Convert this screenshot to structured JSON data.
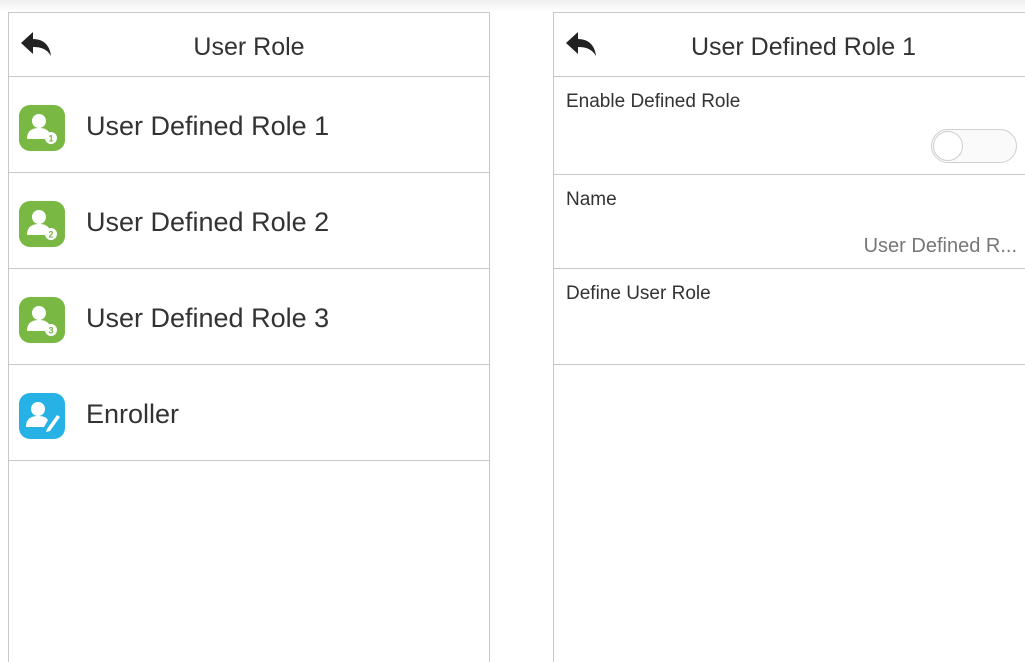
{
  "left_panel": {
    "title": "User Role",
    "back_icon": "back-arrow-icon",
    "items": [
      {
        "label": "User Defined Role 1",
        "icon": "user-role-1-icon",
        "icon_color": "#79b842",
        "badge": "1"
      },
      {
        "label": "User Defined Role 2",
        "icon": "user-role-2-icon",
        "icon_color": "#79b842",
        "badge": "2"
      },
      {
        "label": "User Defined Role 3",
        "icon": "user-role-3-icon",
        "icon_color": "#79b842",
        "badge": "3"
      },
      {
        "label": "Enroller",
        "icon": "enroller-icon",
        "icon_color": "#27b2e6"
      }
    ]
  },
  "right_panel": {
    "title": "User Defined Role 1",
    "back_icon": "back-arrow-icon",
    "settings": [
      {
        "label": "Enable Defined Role",
        "control": "toggle",
        "enabled": false
      },
      {
        "label": "Name",
        "value": "User Defined R..."
      },
      {
        "label": "Define User Role"
      }
    ]
  }
}
